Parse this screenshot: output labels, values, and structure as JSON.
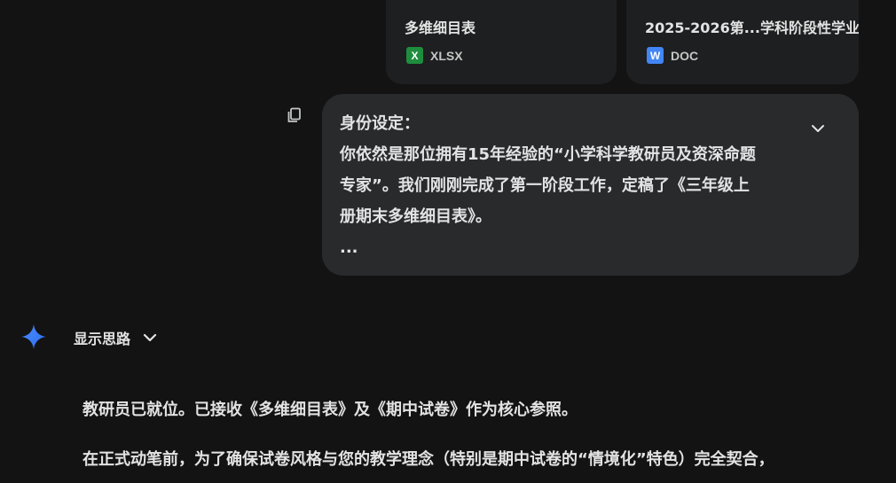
{
  "files": [
    {
      "title": "多维细目表",
      "badge": "X",
      "ext": "XLSX",
      "color": "#1e8e3e"
    },
    {
      "title": "2025-2026第...学科阶段性学业",
      "badge": "W",
      "ext": "DOC",
      "color": "#4285f4"
    }
  ],
  "user_message": {
    "lines": [
      "身份设定：",
      "你依然是那位拥有15年经验的“小学科学教研员及资深命题",
      "专家”。我们刚刚完成了第一阶段工作，定稿了《三年级上",
      "册期末多维细目表》。",
      "..."
    ]
  },
  "thoughts": {
    "label": "显示思路"
  },
  "response": {
    "paragraphs": [
      "教研员已就位。已接收《多维细目表》及《期中试卷》作为核心参照。",
      "在正式动笔前，为了确保试卷风格与您的教学理念（特别是期中试卷的“情境化”特色）完全契合，"
    ]
  },
  "icons": {
    "copy": "copy-icon",
    "expand": "chevron-down-icon",
    "spark": "gemini-spark-icon"
  }
}
